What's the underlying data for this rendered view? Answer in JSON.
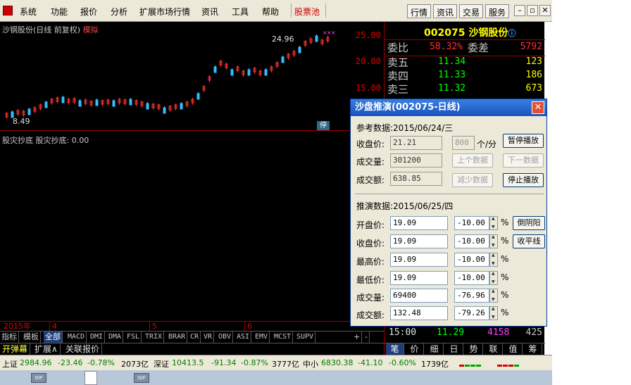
{
  "menu": {
    "items": [
      "系统",
      "功能",
      "报价",
      "分析",
      "扩展市场行情",
      "资讯",
      "工具",
      "帮助"
    ],
    "highlight": "股票池",
    "right_buttons": [
      "行情",
      "资讯",
      "交易",
      "服务"
    ]
  },
  "chart": {
    "title": "沙钢股份(日线 前复权)",
    "mode": "模拟",
    "indicator": "股灾抄底  股灾抄底: 0.00",
    "price_axis": [
      "25.00",
      "20.00",
      "15.00"
    ],
    "peak_label": "24.96",
    "low_label": "8.49",
    "stop_marker": "停",
    "date_ticks": [
      "2015年",
      "4",
      "5",
      "6"
    ],
    "tabs": [
      "指标",
      "模板",
      "全部",
      "MACD",
      "DMI",
      "DMA",
      "FSL",
      "TRIX",
      "BRAR",
      "CR",
      "VR",
      "OBV",
      "ASI",
      "EMV",
      "MCST",
      "SUPV"
    ],
    "tab_controls": [
      "+",
      "-"
    ],
    "tabs2": [
      "开弹幕",
      "扩展∧",
      "关联报价"
    ]
  },
  "quote": {
    "stock": "002075 沙钢股份",
    "rows": [
      {
        "label": "委比",
        "value": "58.32%",
        "label2": "委差",
        "vol": "5792"
      },
      {
        "label": "卖五",
        "value": "11.34",
        "vol": "123"
      },
      {
        "label": "卖四",
        "value": "11.33",
        "vol": "186"
      },
      {
        "label": "卖三",
        "value": "11.32",
        "vol": "673"
      }
    ],
    "tick": {
      "time": "15:00",
      "price": "11.29",
      "vol": "4158",
      "vol2": "425"
    },
    "tabs": [
      "笔",
      "价",
      "细",
      "日",
      "势",
      "联",
      "值",
      "筹"
    ]
  },
  "status": {
    "sh_label": "上证",
    "sh_value": "2984.96",
    "sh_change": "-23.46",
    "sh_pct": "-0.78%",
    "sh_amount": "2073亿",
    "sz_label": "深证",
    "sz_value": "10413.5",
    "sz_change": "-91.34",
    "sz_pct": "-0.87%",
    "sz_amount": "3777亿",
    "zx_label": "中小",
    "zx_value": "6830.38",
    "zx_change": "-41.10",
    "zx_pct": "-0.60%",
    "zx_amount": "1739亿"
  },
  "taskbar": {
    "thumb_label": "GIF"
  },
  "dialog": {
    "title": "沙盘推演(002075-日线)",
    "close": "✕",
    "ref_label": "参考数据:2015/06/24/三",
    "close_price_label": "收盘价:",
    "close_price": "21.21",
    "speed": "800",
    "speed_unit": "个/分",
    "volume_label": "成交量:",
    "volume": "301200",
    "amount_label": "成交额:",
    "amount": "638.85",
    "btn_pause": "暂停播放",
    "btn_prev": "上个数据",
    "btn_next": "下一数据",
    "btn_less": "减少数据",
    "btn_stop": "停止播放",
    "deduce_label": "推演数据:2015/06/25/四",
    "open_label": "开盘价:",
    "open_val": "19.09",
    "open_pct": "-10.00",
    "close2_label": "收盘价:",
    "close2_val": "19.09",
    "close2_pct": "-10.00",
    "high_label": "最高价:",
    "high_val": "19.09",
    "high_pct": "-10.00",
    "low_label": "最低价:",
    "low_val": "19.09",
    "low_pct": "-10.00",
    "vol_label": "成交量:",
    "vol_val": "69400",
    "vol_pct": "-76.96",
    "amt_label": "成交额:",
    "amt_val": "132.48",
    "amt_pct": "-79.26",
    "pct_sign": "%",
    "btn_yinyang": "倒阴阳",
    "btn_flat": "收平线"
  },
  "chart_data": {
    "type": "candlestick",
    "price_range": [
      8.49,
      24.96
    ],
    "tick_labels": [
      "25.00",
      "20.00",
      "15.00"
    ]
  }
}
